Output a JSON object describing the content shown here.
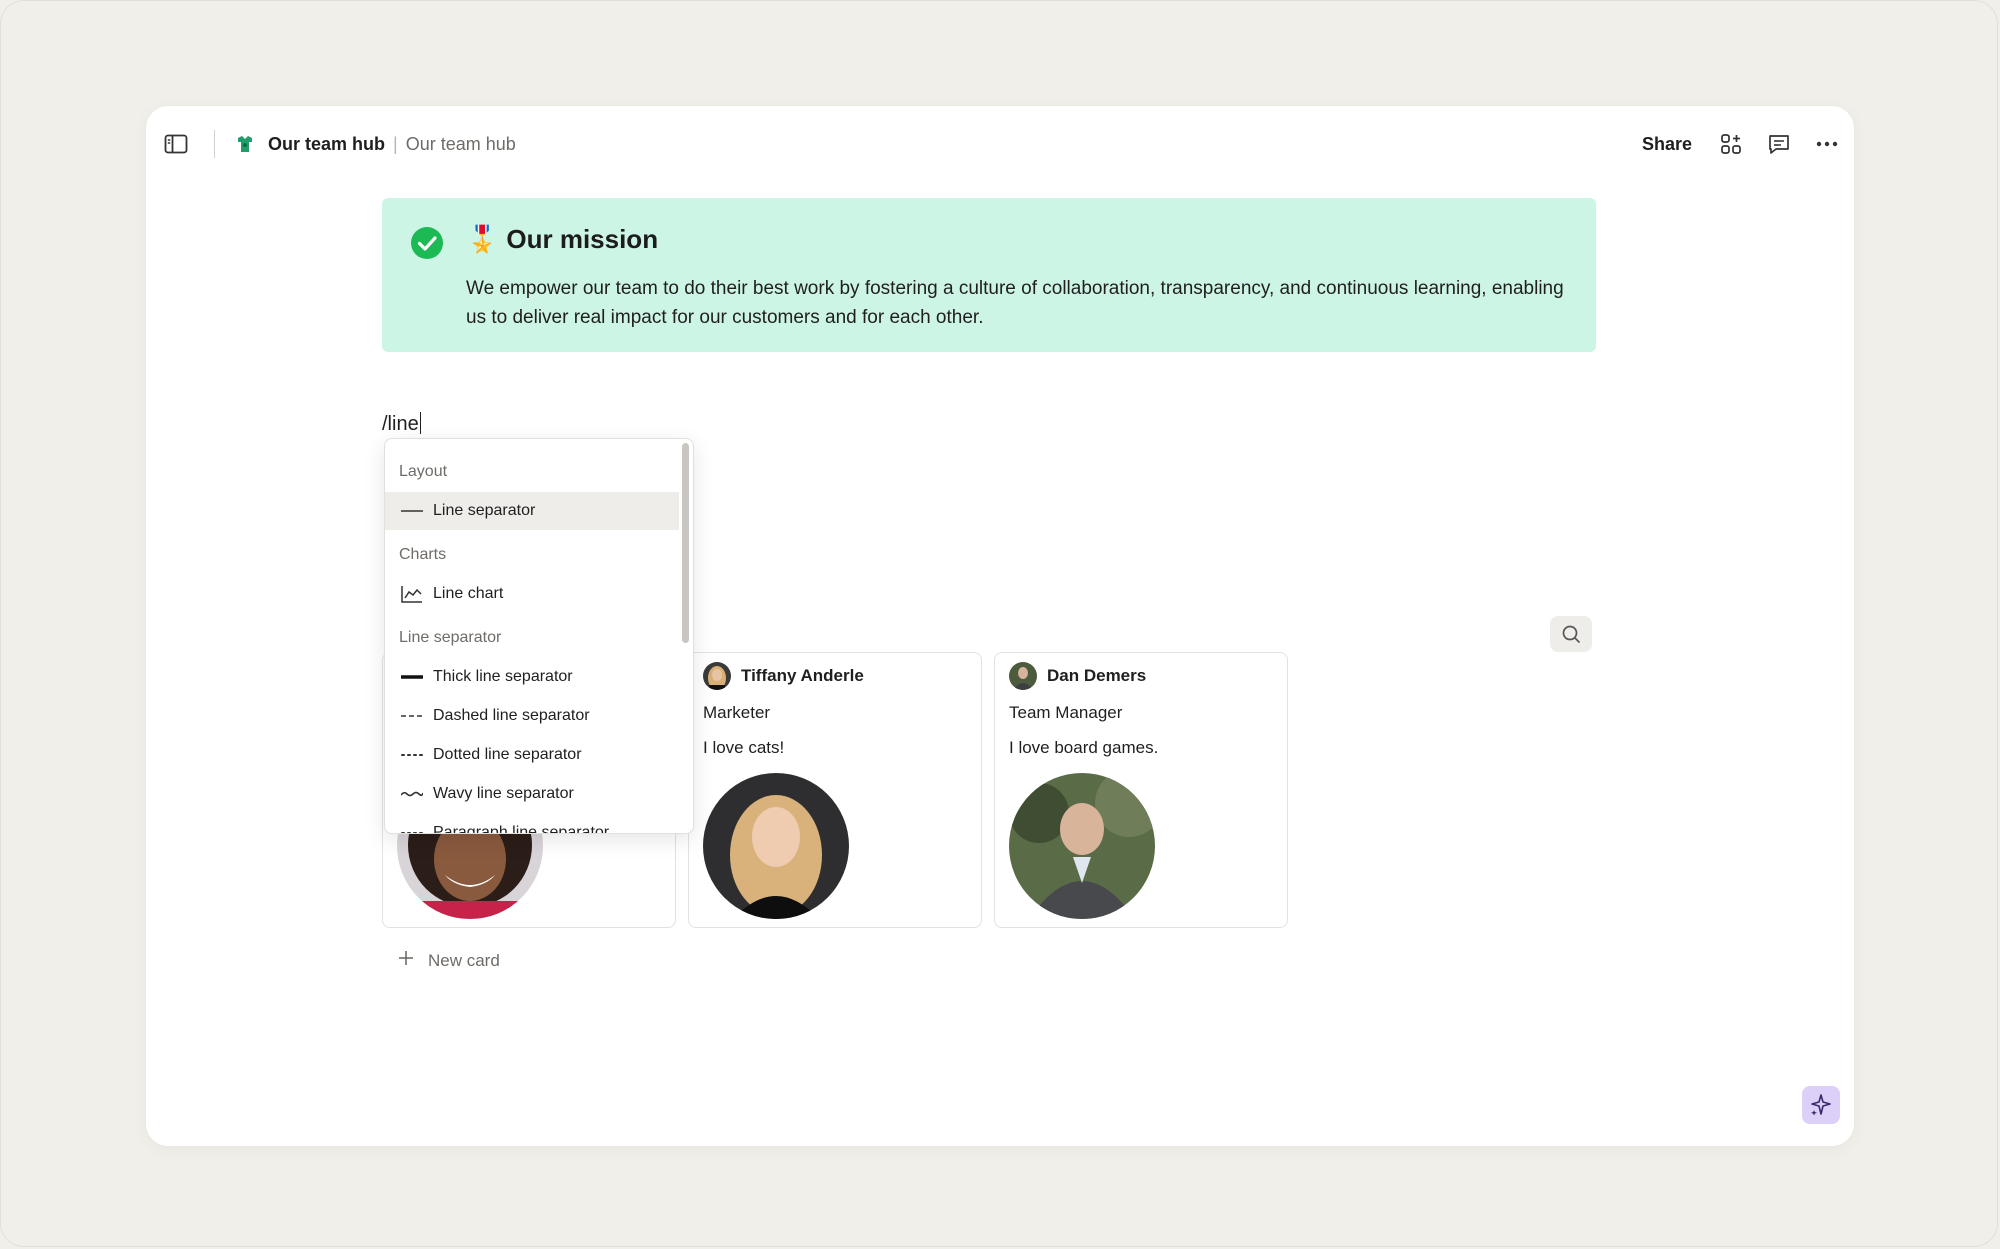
{
  "header": {
    "breadcrumb_main": "Our team hub",
    "breadcrumb_separator": "|",
    "breadcrumb_sub": "Our team hub",
    "share_label": "Share"
  },
  "callout": {
    "emoji": "🎖️",
    "title": "Our mission",
    "body": "We empower our team to do their best work by fostering a culture of collaboration, transparency, and continuous learning, enabling us to deliver real impact for our customers and for each other."
  },
  "editor": {
    "typed_text": "/line"
  },
  "dropdown": {
    "sections": {
      "layout": "Layout",
      "charts": "Charts",
      "line_separator": "Line separator"
    },
    "items": {
      "line_separator": "Line separator",
      "line_chart": "Line chart",
      "thick": "Thick line separator",
      "dashed": "Dashed line separator",
      "dotted": "Dotted line separator",
      "wavy": "Wavy line separator",
      "paragraph": "Paragraph line separator"
    }
  },
  "cards": [
    {
      "name": "",
      "role": "",
      "hobby": ""
    },
    {
      "name": "Tiffany Anderle",
      "role": "Marketer",
      "hobby": "I love cats!"
    },
    {
      "name": "Dan Demers",
      "role": "Team Manager",
      "hobby": "I love board games."
    }
  ],
  "new_card_label": "New card",
  "colors": {
    "background": "#f1efea",
    "callout_bg": "#cdf5e6",
    "check_green": "#1db954",
    "ai_button_bg": "#dccff8",
    "hub_icon": "#1f9d6b"
  },
  "icons": {
    "sidebar_toggle": "sidebar-icon",
    "hub": "team-hub-icon",
    "apps": "apps-add-icon",
    "comments": "comment-icon",
    "more": "more-icon",
    "check": "check-circle-icon",
    "search": "search-icon",
    "ai": "sparkle-icon"
  }
}
